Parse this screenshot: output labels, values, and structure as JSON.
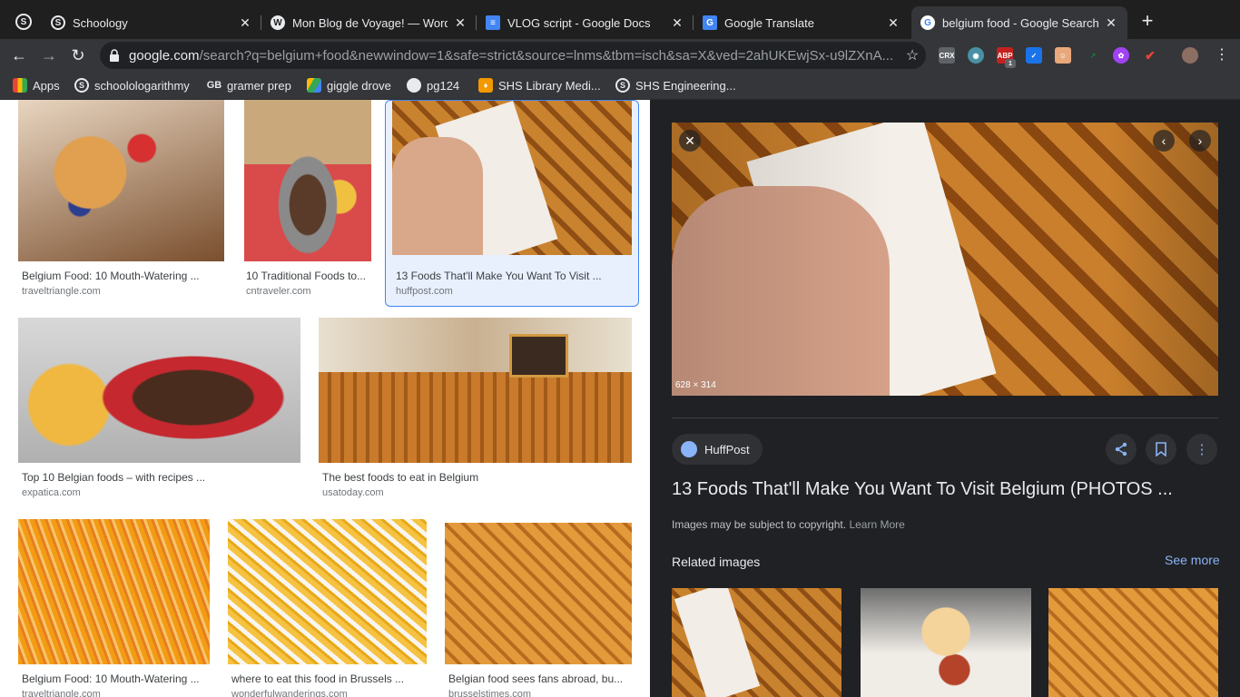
{
  "tabs": [
    {
      "title": "Schoology",
      "active": false
    },
    {
      "title": "Mon Blog de Voyage! — WordPress",
      "active": false
    },
    {
      "title": "VLOG script - Google Docs",
      "active": false
    },
    {
      "title": "Google Translate",
      "active": false
    },
    {
      "title": "belgium food - Google Search",
      "active": true
    }
  ],
  "toolbar": {
    "url_host": "google.com",
    "url_rest": "/search?q=belgium+food&newwindow=1&safe=strict&source=lnms&tbm=isch&sa=X&ved=2ahUKEwjSx-u9lZXnA...",
    "extensions": [
      "CRX",
      "ABP",
      "1"
    ]
  },
  "bookmarks": [
    {
      "label": "Apps"
    },
    {
      "label": "schoolologarithmy"
    },
    {
      "label": "gramer prep"
    },
    {
      "label": "giggle drove"
    },
    {
      "label": "pg124"
    },
    {
      "label": "SHS Library Medi..."
    },
    {
      "label": "SHS Engineering..."
    }
  ],
  "results": [
    {
      "caption": "Belgium Food: 10 Mouth-Watering ...",
      "source": "traveltriangle.com"
    },
    {
      "caption": "10 Traditional Foods to...",
      "source": "cntraveler.com"
    },
    {
      "caption": "13 Foods That'll Make You Want To Visit ...",
      "source": "huffpost.com"
    },
    {
      "caption": "Top 10 Belgian foods – with recipes ...",
      "source": "expatica.com"
    },
    {
      "caption": "The best foods to eat in Belgium",
      "source": "usatoday.com"
    },
    {
      "caption": "Belgium Food: 10 Mouth-Watering ...",
      "source": "traveltriangle.com"
    },
    {
      "caption": "where to eat this food in Brussels ...",
      "source": "wonderfulwanderings.com"
    },
    {
      "caption": "Belgian food sees fans abroad, bu...",
      "source": "brusselstimes.com"
    }
  ],
  "panel": {
    "dimensions": "628 × 314",
    "source_chip": "HuffPost",
    "title": "13 Foods That'll Make You Want To Visit Belgium (PHOTOS ...",
    "copyright": "Images may be subject to copyright.",
    "learn_more": "Learn More",
    "related_heading": "Related images",
    "see_more": "See more"
  }
}
